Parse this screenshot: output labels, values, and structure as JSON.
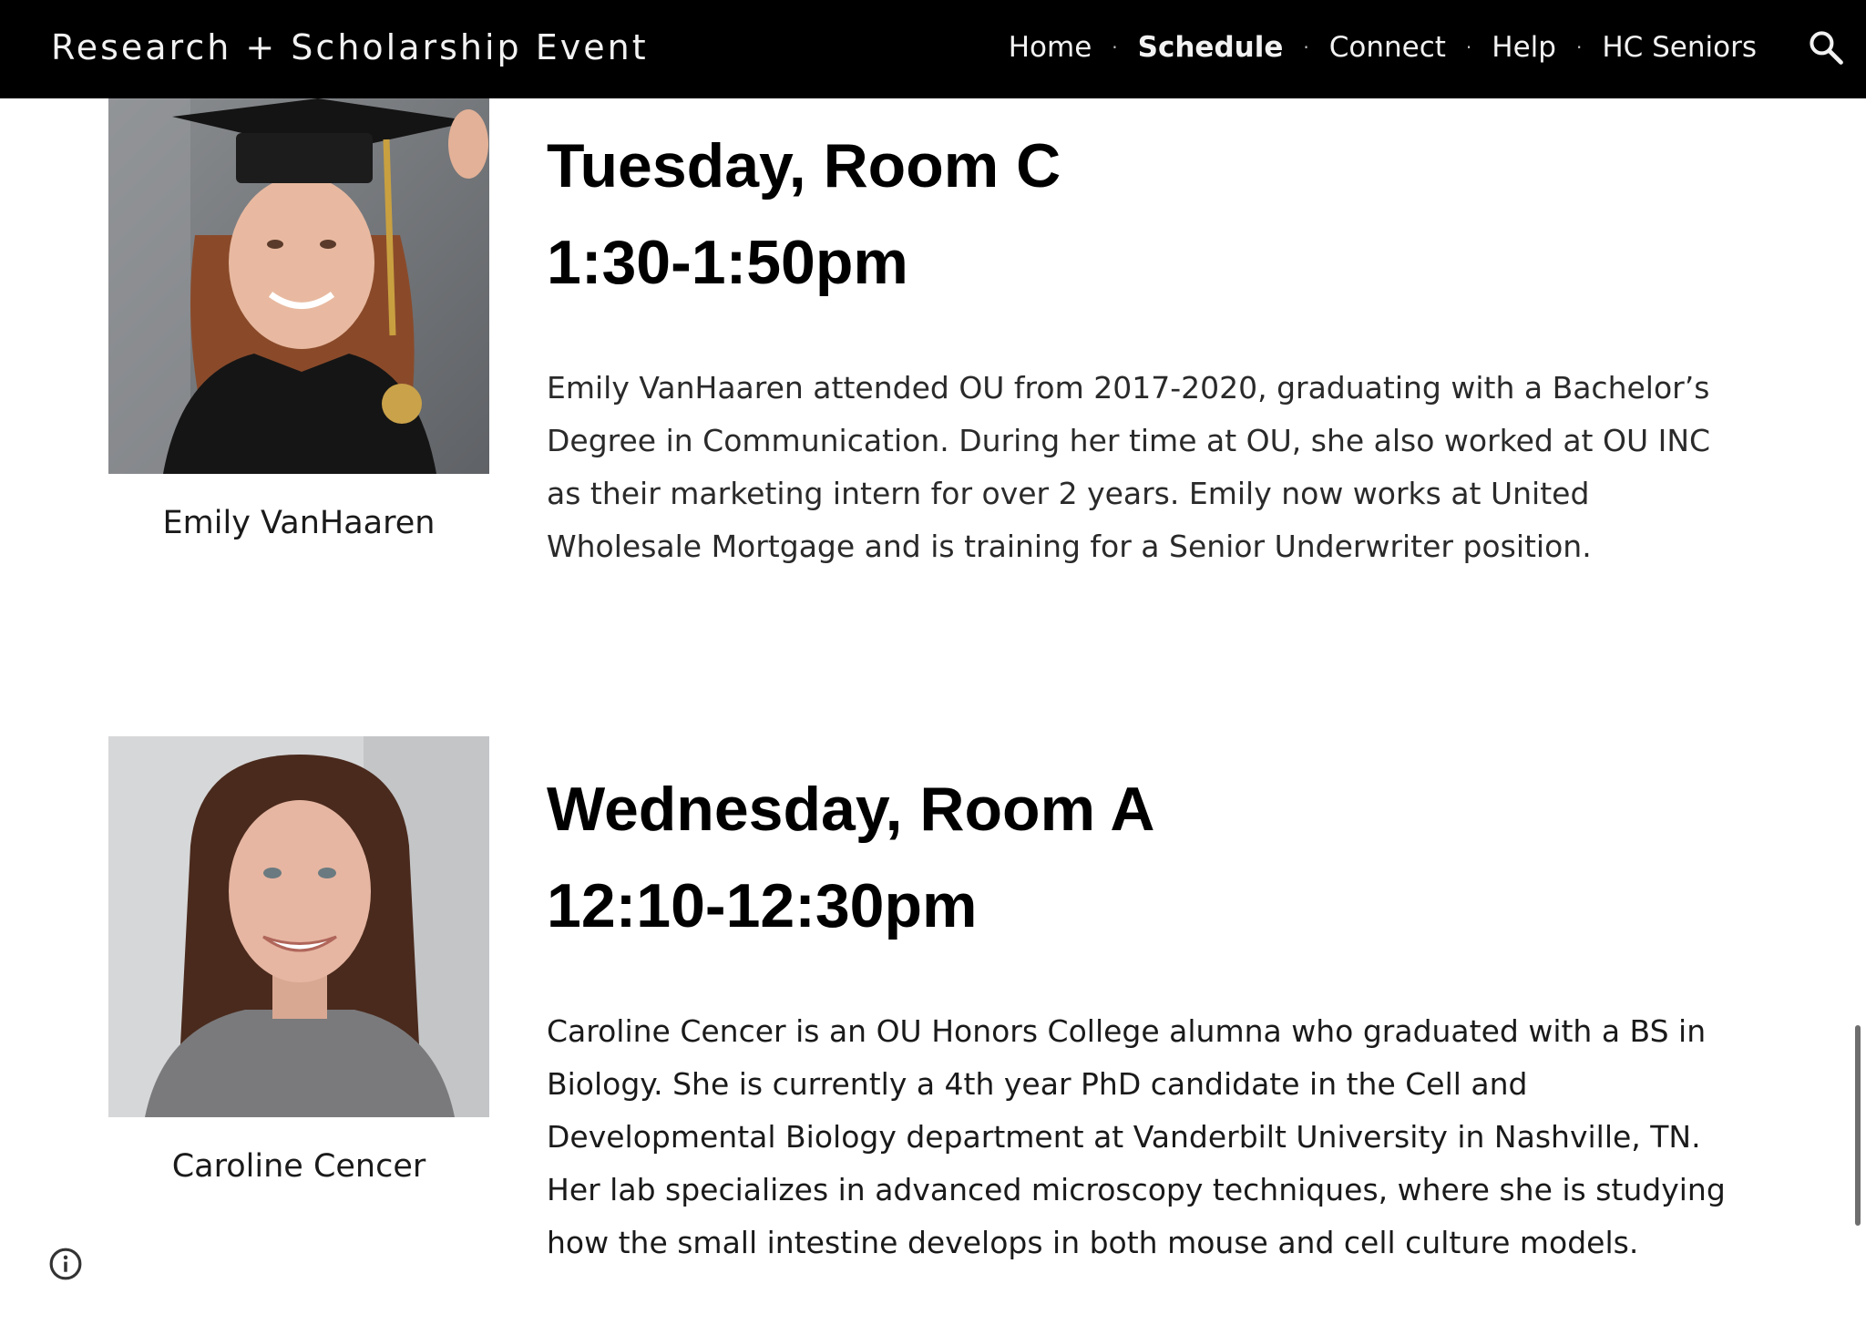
{
  "header": {
    "site_title": "Research + Scholarship Event",
    "nav": [
      {
        "label": "Home",
        "active": false
      },
      {
        "label": "Schedule",
        "active": true
      },
      {
        "label": "Connect",
        "active": false
      },
      {
        "label": "Help",
        "active": false
      },
      {
        "label": "HC Seniors",
        "active": false
      }
    ],
    "separator": "·",
    "search_icon": "search-icon"
  },
  "presenters": [
    {
      "name": "Emily VanHaaren",
      "day_room": "Tuesday, Room C",
      "time": "1:30-1:50pm",
      "bio": "Emily VanHaaren attended OU from 2017-2020, graduating with a Bachelor’s Degree in Communication. During her time at OU, she also worked at OU INC as their marketing intern for over 2 years. Emily now works at United Wholesale Mortgage and is training for a Senior Underwriter position.",
      "photo_icon": "graduation-portrait"
    },
    {
      "name": "Caroline Cencer",
      "day_room": "Wednesday, Room A",
      "time": "12:10-12:30pm",
      "bio": "Caroline Cencer is an OU Honors College alumna who graduated with a BS in Biology. She is currently a 4th year PhD candidate in the Cell and Developmental Biology department at Vanderbilt University in Nashville, TN. Her lab specializes in advanced microscopy techniques, where she is studying how the small intestine develops in both mouse and cell culture models.",
      "photo_icon": "headshot-portrait"
    }
  ],
  "footer": {
    "info_icon": "info-icon"
  },
  "colors": {
    "header_bg": "#000000",
    "header_text": "#f2f2f2",
    "heading_text": "#000000",
    "body_text": "#2a2a2a"
  }
}
